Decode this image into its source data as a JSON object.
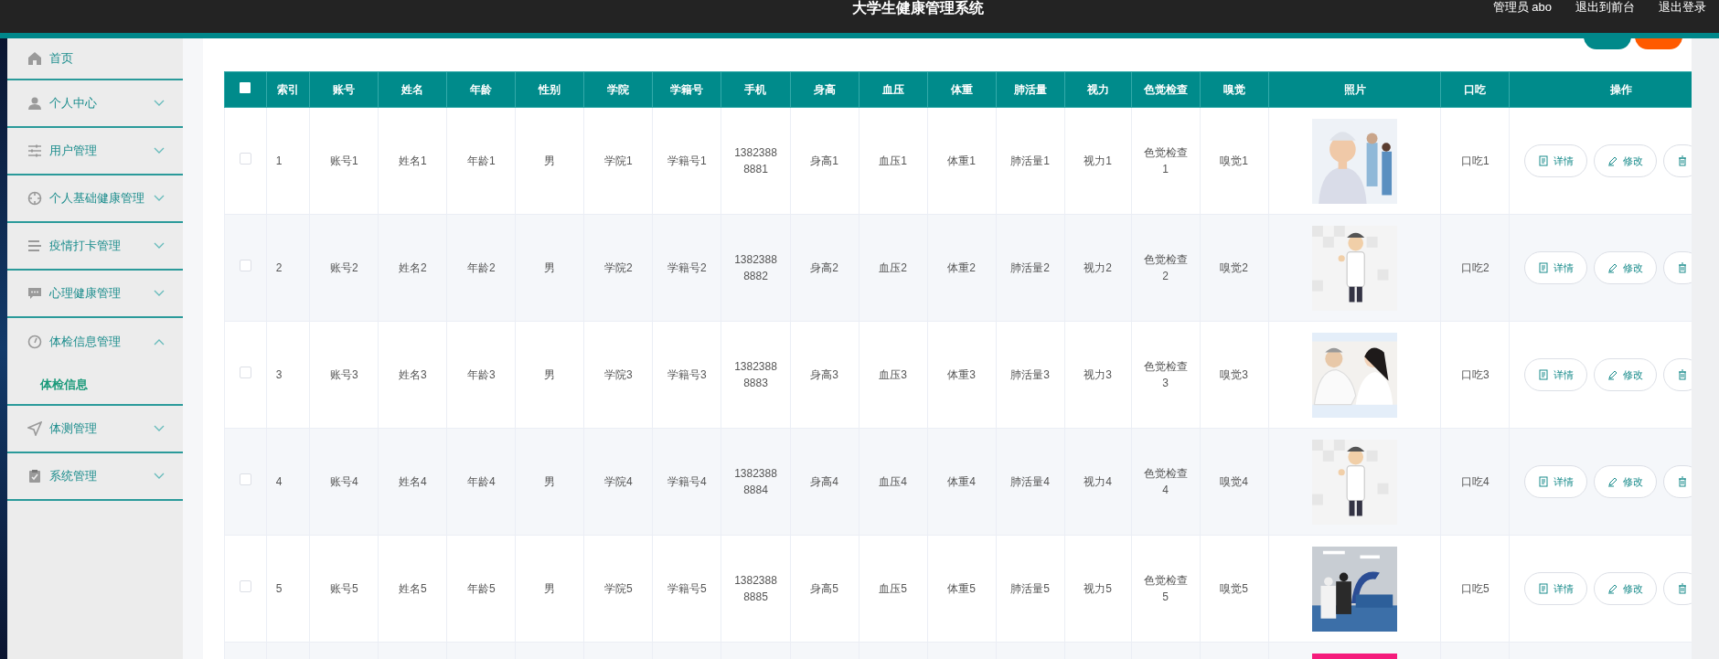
{
  "header": {
    "title": "大学生健康管理系统",
    "user": "管理员 abo",
    "links": [
      "退出到前台",
      "退出登录"
    ]
  },
  "top_buttons": [
    {
      "color": "#00898a"
    },
    {
      "color": "#ff5a00"
    }
  ],
  "sidebar": {
    "items": [
      {
        "label": "首页"
      },
      {
        "label": "个人中心",
        "expanded": false
      },
      {
        "label": "用户管理",
        "expanded": false
      },
      {
        "label": "个人基础健康管理",
        "expanded": false
      },
      {
        "label": "疫情打卡管理",
        "expanded": false
      },
      {
        "label": "心理健康管理",
        "expanded": false
      },
      {
        "label": "体检信息管理",
        "expanded": true,
        "children": [
          {
            "label": "体检信息",
            "selected": true
          }
        ]
      },
      {
        "label": "体测管理",
        "expanded": false
      },
      {
        "label": "系统管理",
        "expanded": false
      }
    ]
  },
  "table": {
    "select_all": {
      "checked": false
    },
    "columns": [
      "索引",
      "账号",
      "姓名",
      "年龄",
      "性别",
      "学院",
      "学籍号",
      "手机",
      "身高",
      "血压",
      "体重",
      "肺活量",
      "视力",
      "色觉检查",
      "嗅觉",
      "照片",
      "口吃",
      "操作"
    ],
    "rows": [
      {
        "checked": false,
        "cells": [
          "1",
          "账号1",
          "姓名1",
          "年龄1",
          "男",
          "学院1",
          "学籍号1",
          "13823888881",
          "身高1",
          "血压1",
          "体重1",
          "肺活量1",
          "视力1",
          "色觉检查1",
          "嗅觉1"
        ],
        "photo": {
          "kind": "picture"
        },
        "stutter": "口吃1",
        "actions": [
          {
            "kind": "detail",
            "label": "详情"
          },
          {
            "kind": "edit",
            "label": "修改"
          },
          {
            "kind": "delete"
          }
        ]
      },
      {
        "checked": false,
        "cells": [
          "2",
          "账号2",
          "姓名2",
          "年龄2",
          "男",
          "学院2",
          "学籍号2",
          "13823888882",
          "身高2",
          "血压2",
          "体重2",
          "肺活量2",
          "视力2",
          "色觉检查2",
          "嗅觉2"
        ],
        "photo": {
          "kind": "picture"
        },
        "stutter": "口吃2",
        "actions": [
          {
            "kind": "detail",
            "label": "详情"
          },
          {
            "kind": "edit",
            "label": "修改"
          },
          {
            "kind": "delete"
          }
        ]
      },
      {
        "checked": false,
        "cells": [
          "3",
          "账号3",
          "姓名3",
          "年龄3",
          "男",
          "学院3",
          "学籍号3",
          "13823888883",
          "身高3",
          "血压3",
          "体重3",
          "肺活量3",
          "视力3",
          "色觉检查3",
          "嗅觉3"
        ],
        "photo": {
          "kind": "picture"
        },
        "stutter": "口吃3",
        "actions": [
          {
            "kind": "detail",
            "label": "详情"
          },
          {
            "kind": "edit",
            "label": "修改"
          },
          {
            "kind": "delete"
          }
        ]
      },
      {
        "checked": false,
        "cells": [
          "4",
          "账号4",
          "姓名4",
          "年龄4",
          "男",
          "学院4",
          "学籍号4",
          "13823888884",
          "身高4",
          "血压4",
          "体重4",
          "肺活量4",
          "视力4",
          "色觉检查4",
          "嗅觉4"
        ],
        "photo": {
          "kind": "picture"
        },
        "stutter": "口吃4",
        "actions": [
          {
            "kind": "detail",
            "label": "详情"
          },
          {
            "kind": "edit",
            "label": "修改"
          },
          {
            "kind": "delete"
          }
        ]
      },
      {
        "checked": false,
        "cells": [
          "5",
          "账号5",
          "姓名5",
          "年龄5",
          "男",
          "学院5",
          "学籍号5",
          "13823888885",
          "身高5",
          "血压5",
          "体重5",
          "肺活量5",
          "视力5",
          "色觉检查5",
          "嗅觉5"
        ],
        "photo": {
          "kind": "picture"
        },
        "stutter": "口吃5",
        "actions": [
          {
            "kind": "detail",
            "label": "详情"
          },
          {
            "kind": "edit",
            "label": "修改"
          },
          {
            "kind": "delete"
          }
        ]
      },
      {
        "photo": {
          "kind": "picture"
        }
      }
    ]
  }
}
